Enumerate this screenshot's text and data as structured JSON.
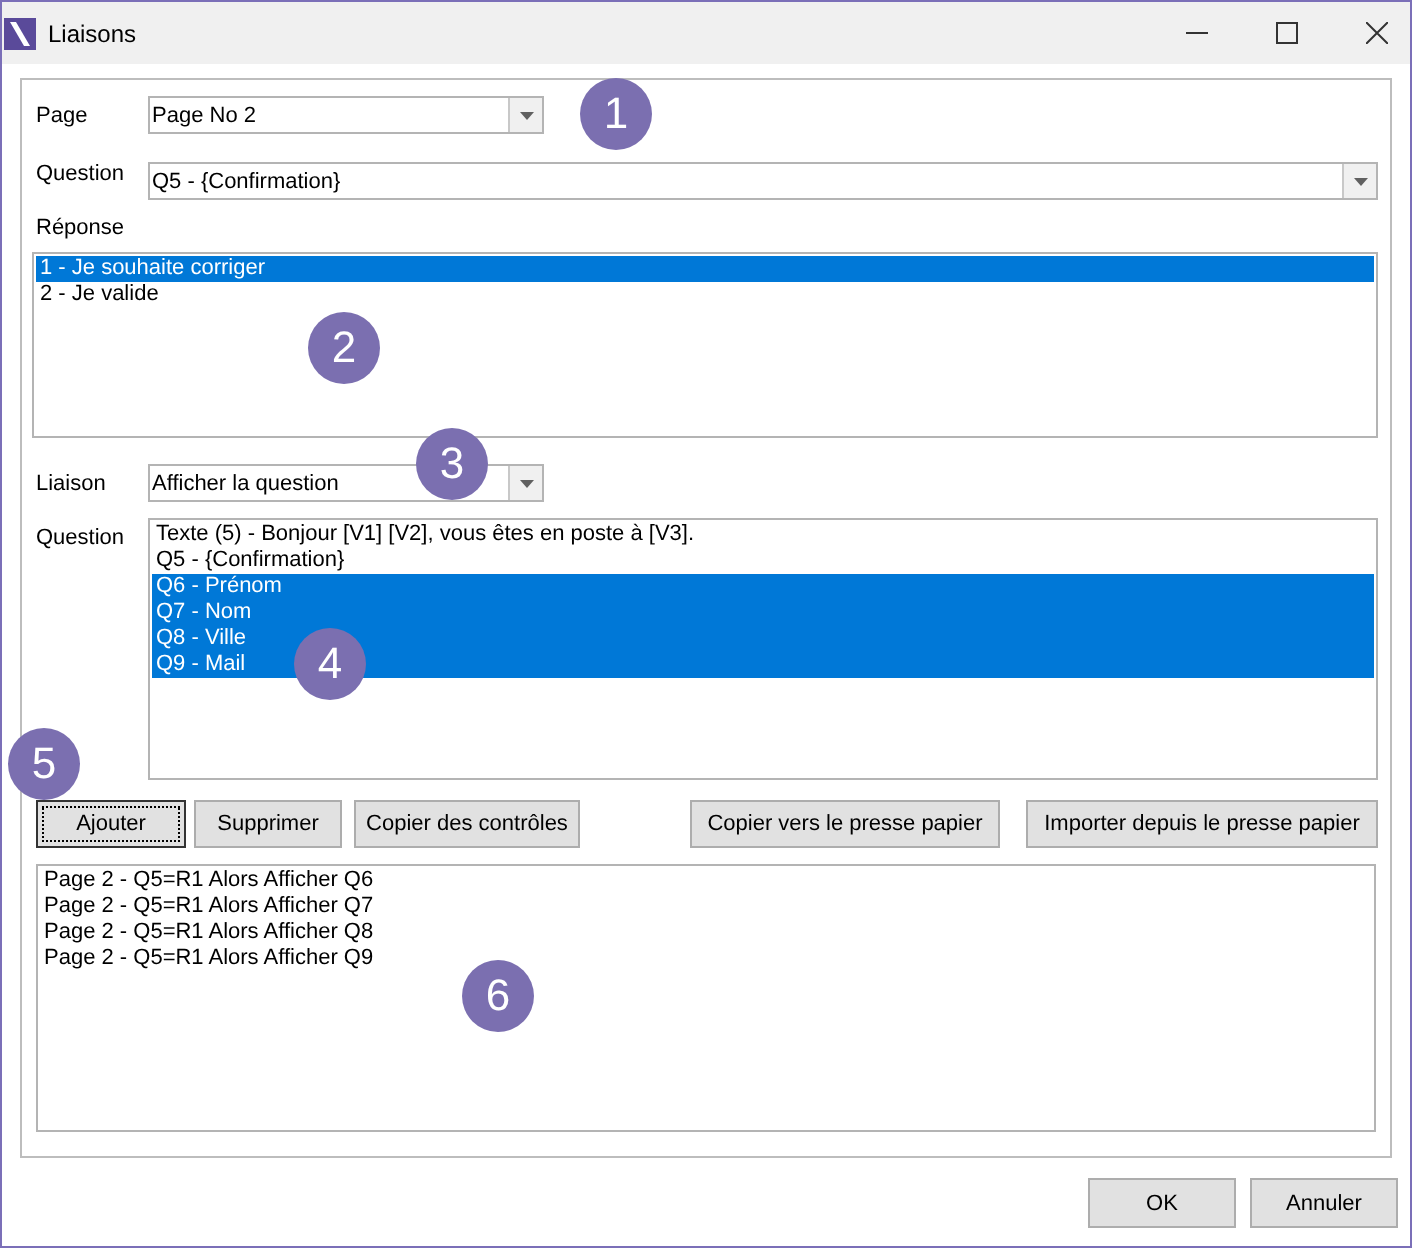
{
  "window": {
    "title": "Liaisons"
  },
  "page": {
    "label": "Page",
    "value": "Page No 2"
  },
  "question": {
    "label": "Question",
    "value": "Q5 - {Confirmation}"
  },
  "reponse": {
    "label": "Réponse",
    "items": [
      {
        "text": "1 - Je souhaite corriger",
        "selected": true
      },
      {
        "text": "2 - Je valide",
        "selected": false
      }
    ]
  },
  "liaison": {
    "label": "Liaison",
    "value": "Afficher la question"
  },
  "questions": {
    "label": "Question",
    "items": [
      {
        "text": "Texte (5) - Bonjour [V1] [V2], vous êtes en poste à [V3].",
        "selected": false
      },
      {
        "text": "Q5 - {Confirmation}",
        "selected": false
      },
      {
        "text": "Q6 - Prénom",
        "selected": true
      },
      {
        "text": "Q7 - Nom",
        "selected": true
      },
      {
        "text": "Q8 - Ville",
        "selected": true
      },
      {
        "text": "Q9 - Mail",
        "selected": true
      }
    ]
  },
  "actions": [
    {
      "label": "Ajouter",
      "focused": true
    },
    {
      "label": "Supprimer",
      "focused": false
    },
    {
      "label": "Copier des contrôles",
      "focused": false
    },
    {
      "label": "Copier vers le presse papier",
      "focused": false
    },
    {
      "label": "Importer depuis le presse papier",
      "focused": false
    }
  ],
  "links": [
    "Page 2 - Q5=R1 Alors Afficher Q6",
    "Page 2 - Q5=R1 Alors Afficher Q7",
    "Page 2 - Q5=R1 Alors Afficher Q8",
    "Page 2 - Q5=R1 Alors Afficher Q9"
  ],
  "buttons": [
    "OK",
    "Annuler"
  ],
  "callouts": [
    "1",
    "2",
    "3",
    "4",
    "5",
    "6"
  ]
}
